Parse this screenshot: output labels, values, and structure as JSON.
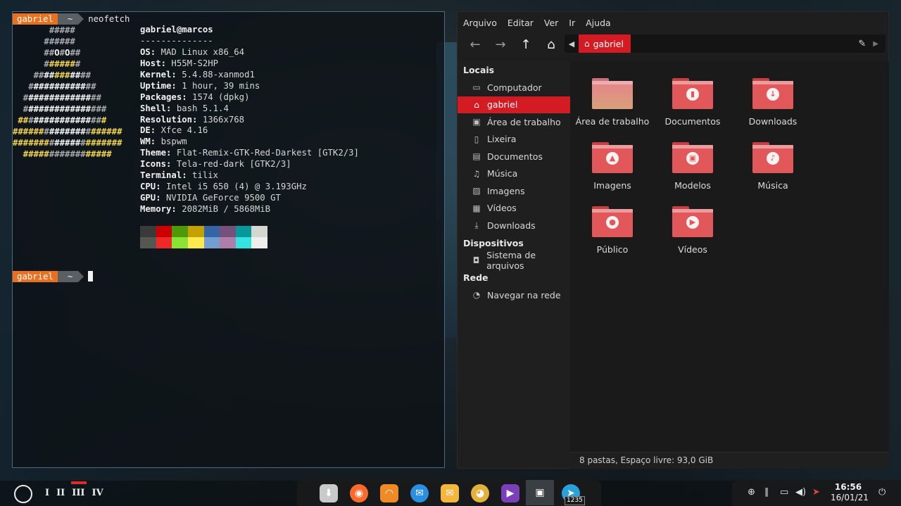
{
  "terminal": {
    "prompt_user": "gabriel",
    "prompt_dir": "~",
    "command": "neofetch",
    "logo_lines": [
      [
        {
          "c": "g",
          "t": "       #####"
        }
      ],
      [
        {
          "c": "g",
          "t": "      ######"
        }
      ],
      [
        {
          "c": "g",
          "t": "      ##"
        },
        {
          "c": "w",
          "t": "O"
        },
        {
          "c": "g",
          "t": "#"
        },
        {
          "c": "w",
          "t": "O"
        },
        {
          "c": "g",
          "t": "##"
        }
      ],
      [
        {
          "c": "g",
          "t": "      #"
        },
        {
          "c": "y",
          "t": "#####"
        },
        {
          "c": "g",
          "t": "#"
        }
      ],
      [
        {
          "c": "g",
          "t": "    ##"
        },
        {
          "c": "w",
          "t": "##"
        },
        {
          "c": "y",
          "t": "###"
        },
        {
          "c": "w",
          "t": "##"
        },
        {
          "c": "g",
          "t": "##"
        }
      ],
      [
        {
          "c": "g",
          "t": "   #"
        },
        {
          "c": "w",
          "t": "##########"
        },
        {
          "c": "g",
          "t": "##"
        }
      ],
      [
        {
          "c": "g",
          "t": "  #"
        },
        {
          "c": "w",
          "t": "############"
        },
        {
          "c": "g",
          "t": "##"
        }
      ],
      [
        {
          "c": "g",
          "t": "  #"
        },
        {
          "c": "w",
          "t": "############"
        },
        {
          "c": "g",
          "t": "###"
        }
      ],
      [
        {
          "c": "y",
          "t": " ##"
        },
        {
          "c": "g",
          "t": "#"
        },
        {
          "c": "w",
          "t": "###########"
        },
        {
          "c": "g",
          "t": "##"
        },
        {
          "c": "y",
          "t": "#"
        }
      ],
      [
        {
          "c": "y",
          "t": "######"
        },
        {
          "c": "g",
          "t": "#"
        },
        {
          "c": "w",
          "t": "#######"
        },
        {
          "c": "g",
          "t": "#"
        },
        {
          "c": "y",
          "t": "######"
        }
      ],
      [
        {
          "c": "y",
          "t": "#######"
        },
        {
          "c": "g",
          "t": "#"
        },
        {
          "c": "w",
          "t": "#####"
        },
        {
          "c": "g",
          "t": "#"
        },
        {
          "c": "y",
          "t": "#######"
        }
      ],
      [
        {
          "c": "y",
          "t": "  #####"
        },
        {
          "c": "g",
          "t": "#######"
        },
        {
          "c": "y",
          "t": "#####"
        }
      ]
    ],
    "title": "gabriel@marcos",
    "separator": "--------------",
    "info": [
      {
        "key": "OS:",
        "value": " MAD Linux x86_64"
      },
      {
        "key": "Host:",
        "value": " H55M-S2HP"
      },
      {
        "key": "Kernel:",
        "value": " 5.4.88-xanmod1"
      },
      {
        "key": "Uptime:",
        "value": " 1 hour, 39 mins"
      },
      {
        "key": "Packages:",
        "value": " 1574 (dpkg)"
      },
      {
        "key": "Shell:",
        "value": " bash 5.1.4"
      },
      {
        "key": "Resolution:",
        "value": " 1366x768"
      },
      {
        "key": "DE:",
        "value": " Xfce 4.16"
      },
      {
        "key": "WM:",
        "value": " bspwm"
      },
      {
        "key": "Theme:",
        "value": " Flat-Remix-GTK-Red-Darkest [GTK2/3]"
      },
      {
        "key": "Icons:",
        "value": " Tela-red-dark [GTK2/3]"
      },
      {
        "key": "Terminal:",
        "value": " tilix"
      },
      {
        "key": "CPU:",
        "value": " Intel i5 650 (4) @ 3.193GHz"
      },
      {
        "key": "GPU:",
        "value": " NVIDIA GeForce 9500 GT"
      },
      {
        "key": "Memory:",
        "value": " 2082MiB / 5868MiB"
      }
    ],
    "palette_dark": [
      "#3a3a3a",
      "#cc0000",
      "#4e9a06",
      "#c4a000",
      "#3465a4",
      "#75507b",
      "#06989a",
      "#d3d7cf"
    ],
    "palette_bright": [
      "#555753",
      "#ef2929",
      "#8ae234",
      "#fce94f",
      "#729fcf",
      "#ad7fa8",
      "#34e2e2",
      "#eeeeec"
    ]
  },
  "file_manager": {
    "menu": [
      "Arquivo",
      "Editar",
      "Ver",
      "Ir",
      "Ajuda"
    ],
    "toolbar_icons": [
      "arrow-back-icon",
      "arrow-forward-icon",
      "arrow-up-icon",
      "home-icon"
    ],
    "breadcrumb": "gabriel",
    "sidebar": {
      "sections": [
        {
          "title": "Locais",
          "items": [
            {
              "label": "Computador",
              "icon": "computer-icon",
              "glyph": "▭"
            },
            {
              "label": "gabriel",
              "icon": "home-icon",
              "glyph": "⌂",
              "active": true
            },
            {
              "label": "Área de trabalho",
              "icon": "desktop-icon",
              "glyph": "▣"
            },
            {
              "label": "Lixeira",
              "icon": "trash-icon",
              "glyph": "▯"
            },
            {
              "label": "Documentos",
              "icon": "document-icon",
              "glyph": "▤"
            },
            {
              "label": "Música",
              "icon": "music-icon",
              "glyph": "♫"
            },
            {
              "label": "Imagens",
              "icon": "image-icon",
              "glyph": "▨"
            },
            {
              "label": "Vídeos",
              "icon": "video-icon",
              "glyph": "▦"
            },
            {
              "label": "Downloads",
              "icon": "download-icon",
              "glyph": "⤓"
            }
          ]
        },
        {
          "title": "Dispositivos",
          "items": [
            {
              "label": "Sistema de arquivos",
              "icon": "drive-icon",
              "glyph": "◘"
            }
          ]
        },
        {
          "title": "Rede",
          "items": [
            {
              "label": "Navegar na rede",
              "icon": "network-icon",
              "glyph": "◔"
            }
          ]
        }
      ]
    },
    "folders": [
      {
        "label": "Área de trabalho",
        "icon": "desktop-folder-icon",
        "glyph": "",
        "kind": "desk"
      },
      {
        "label": "Documentos",
        "icon": "documents-folder-icon",
        "glyph": "▮"
      },
      {
        "label": "Downloads",
        "icon": "downloads-folder-icon",
        "glyph": "↓"
      },
      {
        "label": "Imagens",
        "icon": "pictures-folder-icon",
        "glyph": "▲"
      },
      {
        "label": "Modelos",
        "icon": "templates-folder-icon",
        "glyph": "▣"
      },
      {
        "label": "Música",
        "icon": "music-folder-icon",
        "glyph": "♪"
      },
      {
        "label": "Público",
        "icon": "public-folder-icon",
        "glyph": "●"
      },
      {
        "label": "Vídeos",
        "icon": "videos-folder-icon",
        "glyph": "▶"
      }
    ],
    "status": "8 pastas, Espaço livre: 93,0 GiB"
  },
  "panel": {
    "workspaces": [
      "I",
      "II",
      "III",
      "IV"
    ],
    "dock_apps": [
      {
        "name": "installer-icon",
        "glyph": "⬇",
        "color": "#c9c9c9"
      },
      {
        "name": "firefox-icon",
        "glyph": "◉",
        "color": "#ff6a2a"
      },
      {
        "name": "rss-icon",
        "glyph": "◠",
        "color": "#f08a24"
      },
      {
        "name": "thunderbird-icon",
        "glyph": "✉",
        "color": "#2a8fe0"
      },
      {
        "name": "mail-icon",
        "glyph": "✉",
        "color": "#f4b63d"
      },
      {
        "name": "pidgin-icon",
        "glyph": "◕",
        "color": "#e3b23c"
      },
      {
        "name": "media-player-icon",
        "glyph": "▶",
        "color": "#7b3fb8"
      },
      {
        "name": "terminal-icon",
        "glyph": "▣",
        "color": "#5a5f64"
      },
      {
        "name": "telegram-icon",
        "glyph": "➤",
        "color": "#2aa1da"
      }
    ],
    "telegram_badge": "1235",
    "tray_icons": [
      "add-icon",
      "attach-icon",
      "window-icon",
      "volume-icon",
      "notification-icon"
    ],
    "clock_time": "16:56",
    "clock_date": "16/01/21"
  }
}
